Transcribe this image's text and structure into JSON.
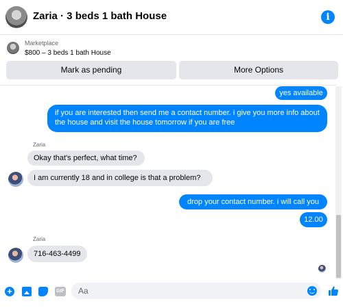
{
  "header": {
    "title": "Zaria · 3 beds 1 bath House",
    "info_icon": "info-icon"
  },
  "marketplace": {
    "label": "Marketplace",
    "listing": "$800 – 3 beds 1 bath House",
    "pending_button": "Mark as pending",
    "more_button": "More Options"
  },
  "messages": [
    {
      "from": "me",
      "text": "yes available"
    },
    {
      "from": "me",
      "text": "if you are interested then send me a contact number. i give you more info about the house and visit the house tomorrow if you are free"
    },
    {
      "from": "Zaria",
      "sender": "Zaria",
      "text": "Okay that's perfect, what time?"
    },
    {
      "from": "Zaria",
      "text": "I am currently 18 and in college is that a problem?"
    },
    {
      "from": "me",
      "text": "drop your contact number. i will call you"
    },
    {
      "from": "me",
      "text": "12.00"
    },
    {
      "from": "Zaria",
      "sender": "Zaria",
      "text": "716-463-4499"
    }
  ],
  "composer": {
    "placeholder": "Aa",
    "icons": [
      "plus-icon",
      "photo-icon",
      "sticker-icon",
      "gif-icon",
      "emoji-icon",
      "thumbs-up-icon"
    ],
    "gif_label": "GIF"
  },
  "colors": {
    "accent": "#0084ff",
    "incoming_bubble": "#e4e6eb",
    "button_bg": "#e4e6eb"
  }
}
